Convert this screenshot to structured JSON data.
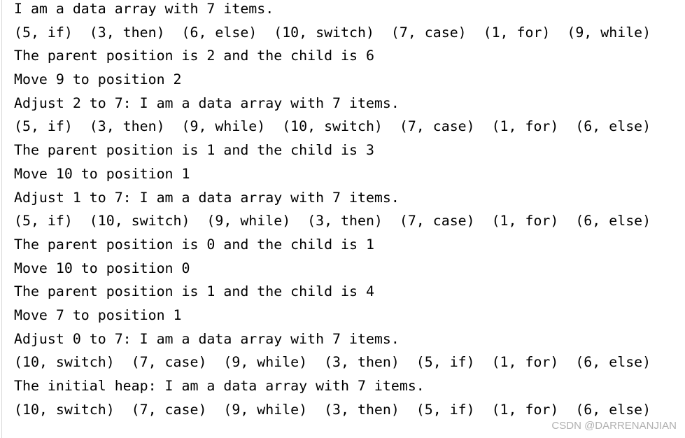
{
  "console": {
    "lines": [
      "I am a data array with 7 items.",
      "(5, if)  (3, then)  (6, else)  (10, switch)  (7, case)  (1, for)  (9, while)",
      "The parent position is 2 and the child is 6",
      "Move 9 to position 2",
      "Adjust 2 to 7: I am a data array with 7 items.",
      "(5, if)  (3, then)  (9, while)  (10, switch)  (7, case)  (1, for)  (6, else)",
      "The parent position is 1 and the child is 3",
      "Move 10 to position 1",
      "Adjust 1 to 7: I am a data array with 7 items.",
      "(5, if)  (10, switch)  (9, while)  (3, then)  (7, case)  (1, for)  (6, else)",
      "The parent position is 0 and the child is 1",
      "Move 10 to position 0",
      "The parent position is 1 and the child is 4",
      "Move 7 to position 1",
      "Adjust 0 to 7: I am a data array with 7 items.",
      "(10, switch)  (7, case)  (9, while)  (3, then)  (5, if)  (1, for)  (6, else)",
      "The initial heap: I am a data array with 7 items.",
      "(10, switch)  (7, case)  (9, while)  (3, then)  (5, if)  (1, for)  (6, else)"
    ]
  },
  "watermark": "CSDN @DARRENANJIAN"
}
